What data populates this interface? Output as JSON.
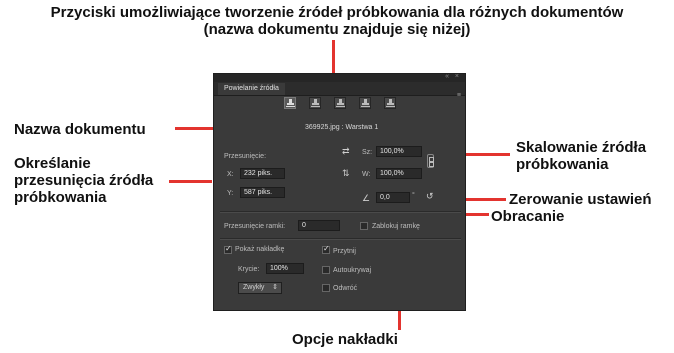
{
  "callouts": {
    "title_line1": "Przyciski umożliwiające tworzenie źródeł próbkowania dla różnych dokumentów",
    "title_line2": "(nazwa dokumentu znajduje się niżej)",
    "doc_name": "Nazwa dokumentu",
    "offset_line1": "Określanie",
    "offset_line2": "przesunięcia źródła",
    "offset_line3": "próbkowania",
    "scale_line1": "Skalowanie źródła",
    "scale_line2": "próbkowania",
    "reset": "Zerowanie ustawień",
    "rotate": "Obracanie",
    "overlay": "Opcje nakładki"
  },
  "panel": {
    "tab_label": "Powielanie źródła",
    "window_controls": "« ×",
    "menu_icon": "≡",
    "doc_label": "369925.jpg : Warstwa 1",
    "offset_label": "Przesunięcie:",
    "x_label": "X:",
    "x_value": "232 piks.",
    "y_label": "Y:",
    "y_value": "587 piks.",
    "w_label": "Sz:",
    "w_value": "100,0%",
    "h_label": "W:",
    "h_value": "100,0%",
    "angle_value": "0,0",
    "degree": "°",
    "frame_offset_label": "Przesunięcie ramki:",
    "frame_offset_value": "0",
    "lock_frame_label": "Zablokuj ramkę",
    "show_overlay_label": "Pokaż nakładkę",
    "opacity_label": "Krycie:",
    "opacity_value": "100%",
    "blend_mode": "Zwykły",
    "clip_label": "Przytnij",
    "autohide_label": "Autoukrywaj",
    "invert_label": "Odwróć",
    "colors": {
      "panel_bg": "#3a3a3a",
      "callout_line": "#e3342f"
    }
  }
}
